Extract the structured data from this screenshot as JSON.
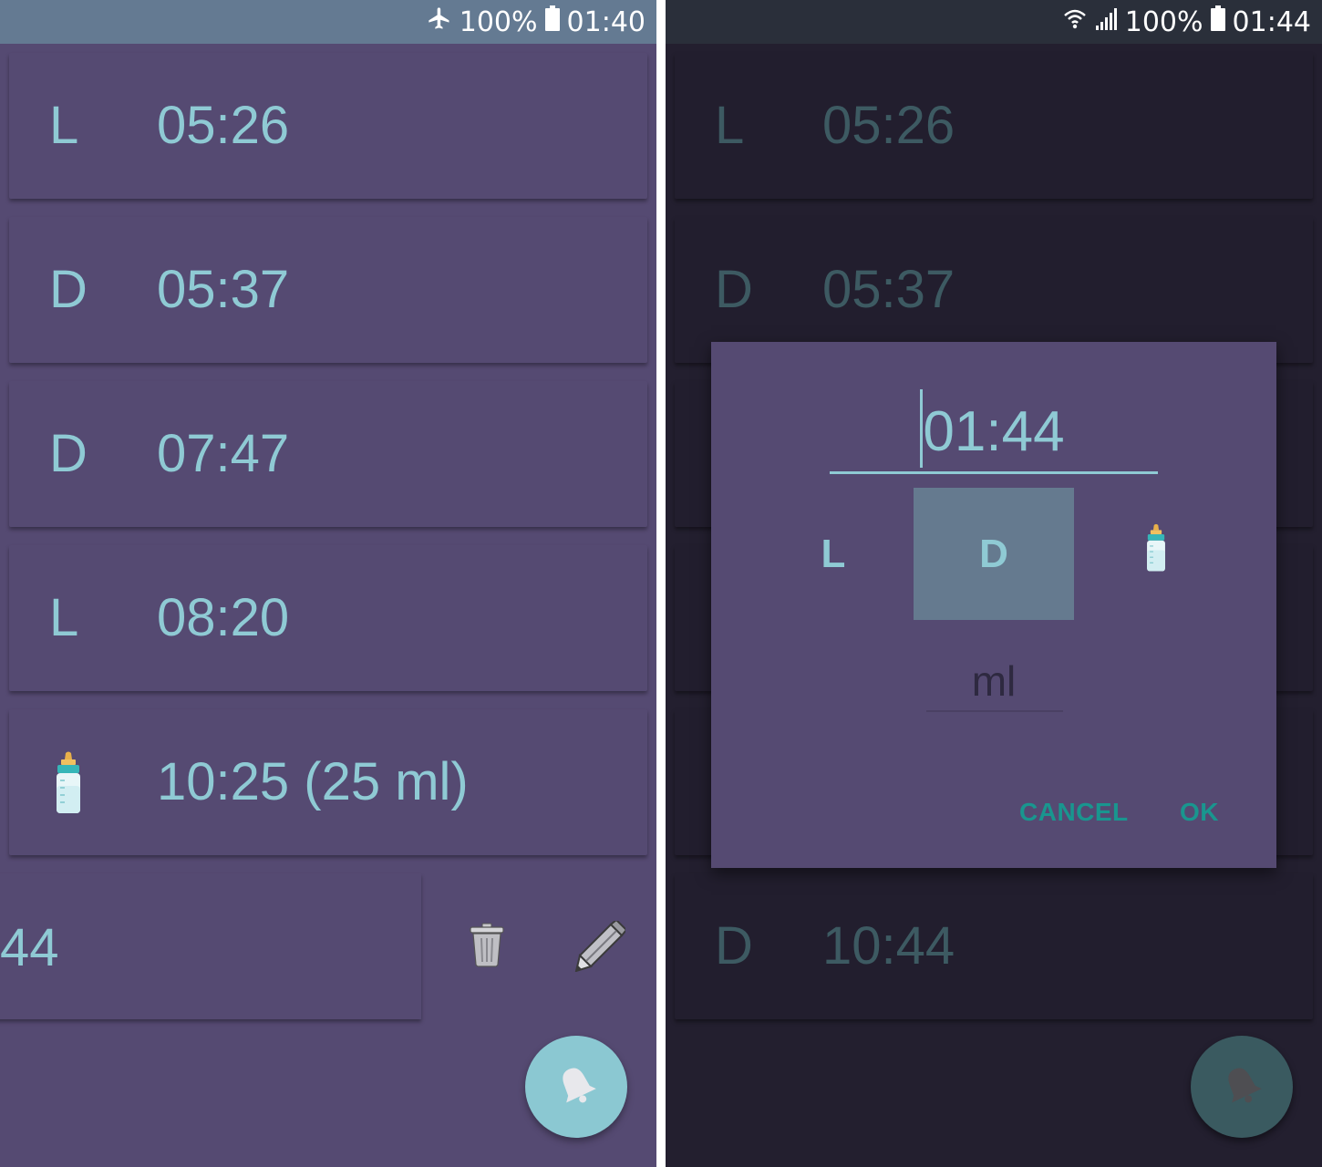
{
  "left_screen": {
    "status_bar": {
      "battery": "100%",
      "time": "01:40",
      "icons": [
        "airplane-mode-icon",
        "battery-icon"
      ]
    },
    "entries": [
      {
        "type": "L",
        "time": "05:26"
      },
      {
        "type": "D",
        "time": "05:37"
      },
      {
        "type": "D",
        "time": "07:47"
      },
      {
        "type": "L",
        "time": "08:20"
      },
      {
        "type": "bottle-icon",
        "time": "10:25 (25 ml)"
      }
    ],
    "swiped_entry": {
      "visible_text": "44"
    },
    "swipe_actions": [
      "trash-icon",
      "pencil-icon"
    ],
    "fab_icon": "bell-icon"
  },
  "right_screen": {
    "status_bar": {
      "battery": "100%",
      "time": "01:44",
      "icons": [
        "wifi-icon",
        "signal-icon",
        "battery-icon"
      ]
    },
    "entries": [
      {
        "type": "L",
        "time": "05:26"
      },
      {
        "type": "D",
        "time": "05:37"
      },
      {
        "type": "D",
        "time": "10:44"
      }
    ],
    "dialog": {
      "time_value": "01:44",
      "options": [
        {
          "label": "L",
          "selected": false
        },
        {
          "label": "D",
          "selected": true
        },
        {
          "label": "",
          "icon": "bottle-icon",
          "selected": false
        }
      ],
      "ml_placeholder": "ml",
      "cancel_label": "CANCEL",
      "ok_label": "OK"
    },
    "fab_icon": "bell-icon"
  },
  "colors": {
    "background": "#554a72",
    "status_bar_left": "#647a92",
    "accent_text": "#8fcad4",
    "selected_option": "#657a8f",
    "dialog_buttons": "#19968f",
    "dimmed_background": "#231f2f"
  }
}
